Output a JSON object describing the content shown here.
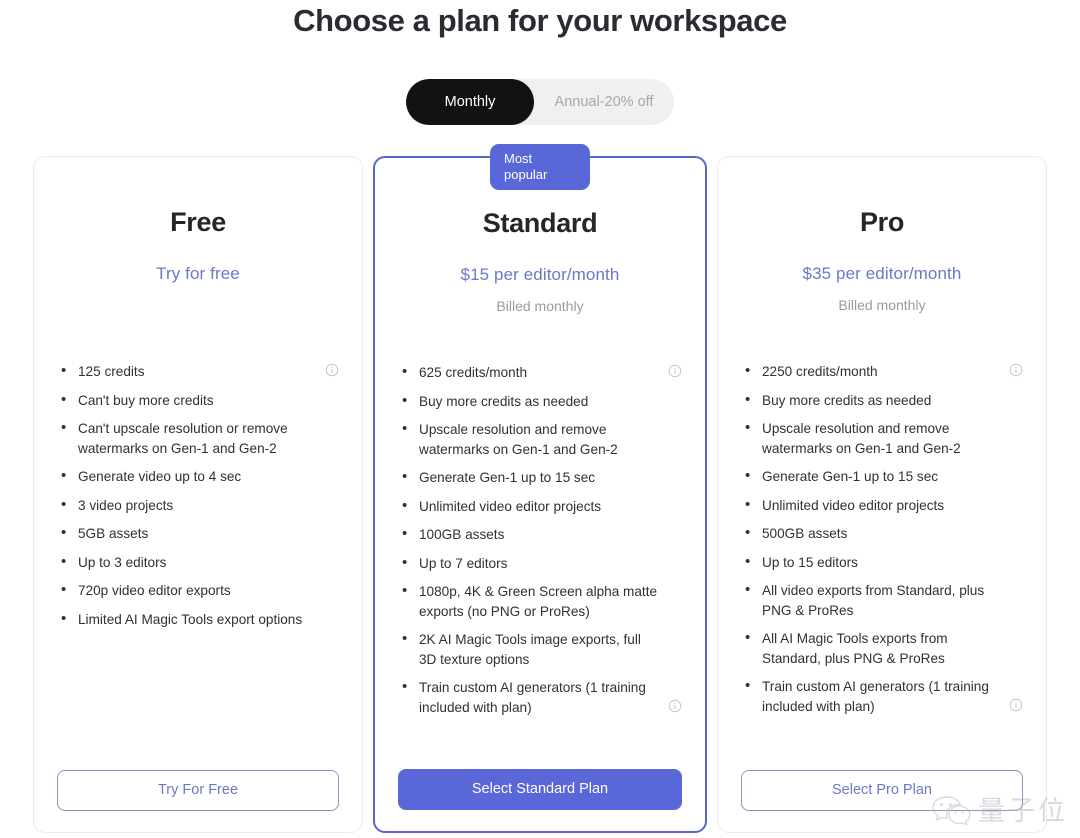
{
  "header": {
    "title": "Choose a plan for your workspace"
  },
  "billing_toggle": {
    "options": [
      {
        "label": "Monthly",
        "active": true
      },
      {
        "label": "Annual-20% off",
        "active": false
      }
    ]
  },
  "colors": {
    "accent": "#5a67d8",
    "accent_text": "#6d78c4",
    "toggle_active_bg": "#121214",
    "toggle_track_bg": "#f0f0f1",
    "muted_text": "#9a9aa2",
    "card_border": "#ececee",
    "featured_border": "#5a67c8"
  },
  "plans": [
    {
      "name": "Free",
      "price": "Try for free",
      "billing": "",
      "featured": false,
      "badge": null,
      "features": [
        {
          "text": "125 credits",
          "info": true,
          "info_line": 1
        },
        {
          "text": "Can't buy more credits",
          "info": false
        },
        {
          "text": "Can't upscale resolution or remove watermarks on Gen-1 and Gen-2",
          "info": false
        },
        {
          "text": "Generate video up to 4 sec",
          "info": false
        },
        {
          "text": "3 video projects",
          "info": false
        },
        {
          "text": "5GB assets",
          "info": false
        },
        {
          "text": "Up to 3 editors",
          "info": false
        },
        {
          "text": "720p video editor exports",
          "info": false
        },
        {
          "text": "Limited AI Magic Tools export options",
          "info": false
        }
      ],
      "cta": {
        "label": "Try For Free",
        "style": "outline"
      }
    },
    {
      "name": "Standard",
      "price": "$15 per editor/month",
      "billing": "Billed monthly",
      "featured": true,
      "badge": "Most\npopular",
      "features": [
        {
          "text": "625 credits/month",
          "info": true,
          "info_line": 1
        },
        {
          "text": "Buy more credits as needed",
          "info": false
        },
        {
          "text": "Upscale resolution and remove watermarks on Gen-1 and Gen-2",
          "info": false
        },
        {
          "text": "Generate Gen-1 up to 15 sec",
          "info": false
        },
        {
          "text": "Unlimited video editor projects",
          "info": false
        },
        {
          "text": "100GB assets",
          "info": false
        },
        {
          "text": "Up to 7 editors",
          "info": false
        },
        {
          "text": "1080p, 4K & Green Screen alpha matte exports (no PNG or ProRes)",
          "info": false
        },
        {
          "text": "2K AI Magic Tools image exports, full 3D texture options",
          "info": false
        },
        {
          "text": "Train custom AI generators (1 training included with plan)",
          "info": true,
          "info_line": 2
        }
      ],
      "cta": {
        "label": "Select Standard Plan",
        "style": "filled"
      }
    },
    {
      "name": "Pro",
      "price": "$35 per editor/month",
      "billing": "Billed monthly",
      "featured": false,
      "badge": null,
      "features": [
        {
          "text": "2250 credits/month",
          "info": true,
          "info_line": 1
        },
        {
          "text": "Buy more credits as needed",
          "info": false
        },
        {
          "text": "Upscale resolution and remove watermarks on Gen-1 and Gen-2",
          "info": false
        },
        {
          "text": "Generate Gen-1 up to 15 sec",
          "info": false
        },
        {
          "text": "Unlimited video editor projects",
          "info": false
        },
        {
          "text": "500GB assets",
          "info": false
        },
        {
          "text": "Up to 15 editors",
          "info": false
        },
        {
          "text": "All video exports from Standard, plus PNG & ProRes",
          "info": false
        },
        {
          "text": "All AI Magic Tools exports from Standard, plus PNG & ProRes",
          "info": false
        },
        {
          "text": "Train custom AI generators (1 training included with plan)",
          "info": true,
          "info_line": 2
        }
      ],
      "cta": {
        "label": "Select Pro Plan",
        "style": "outline"
      }
    }
  ],
  "watermark": {
    "text": "量子位",
    "icon": "wechat-icon"
  }
}
